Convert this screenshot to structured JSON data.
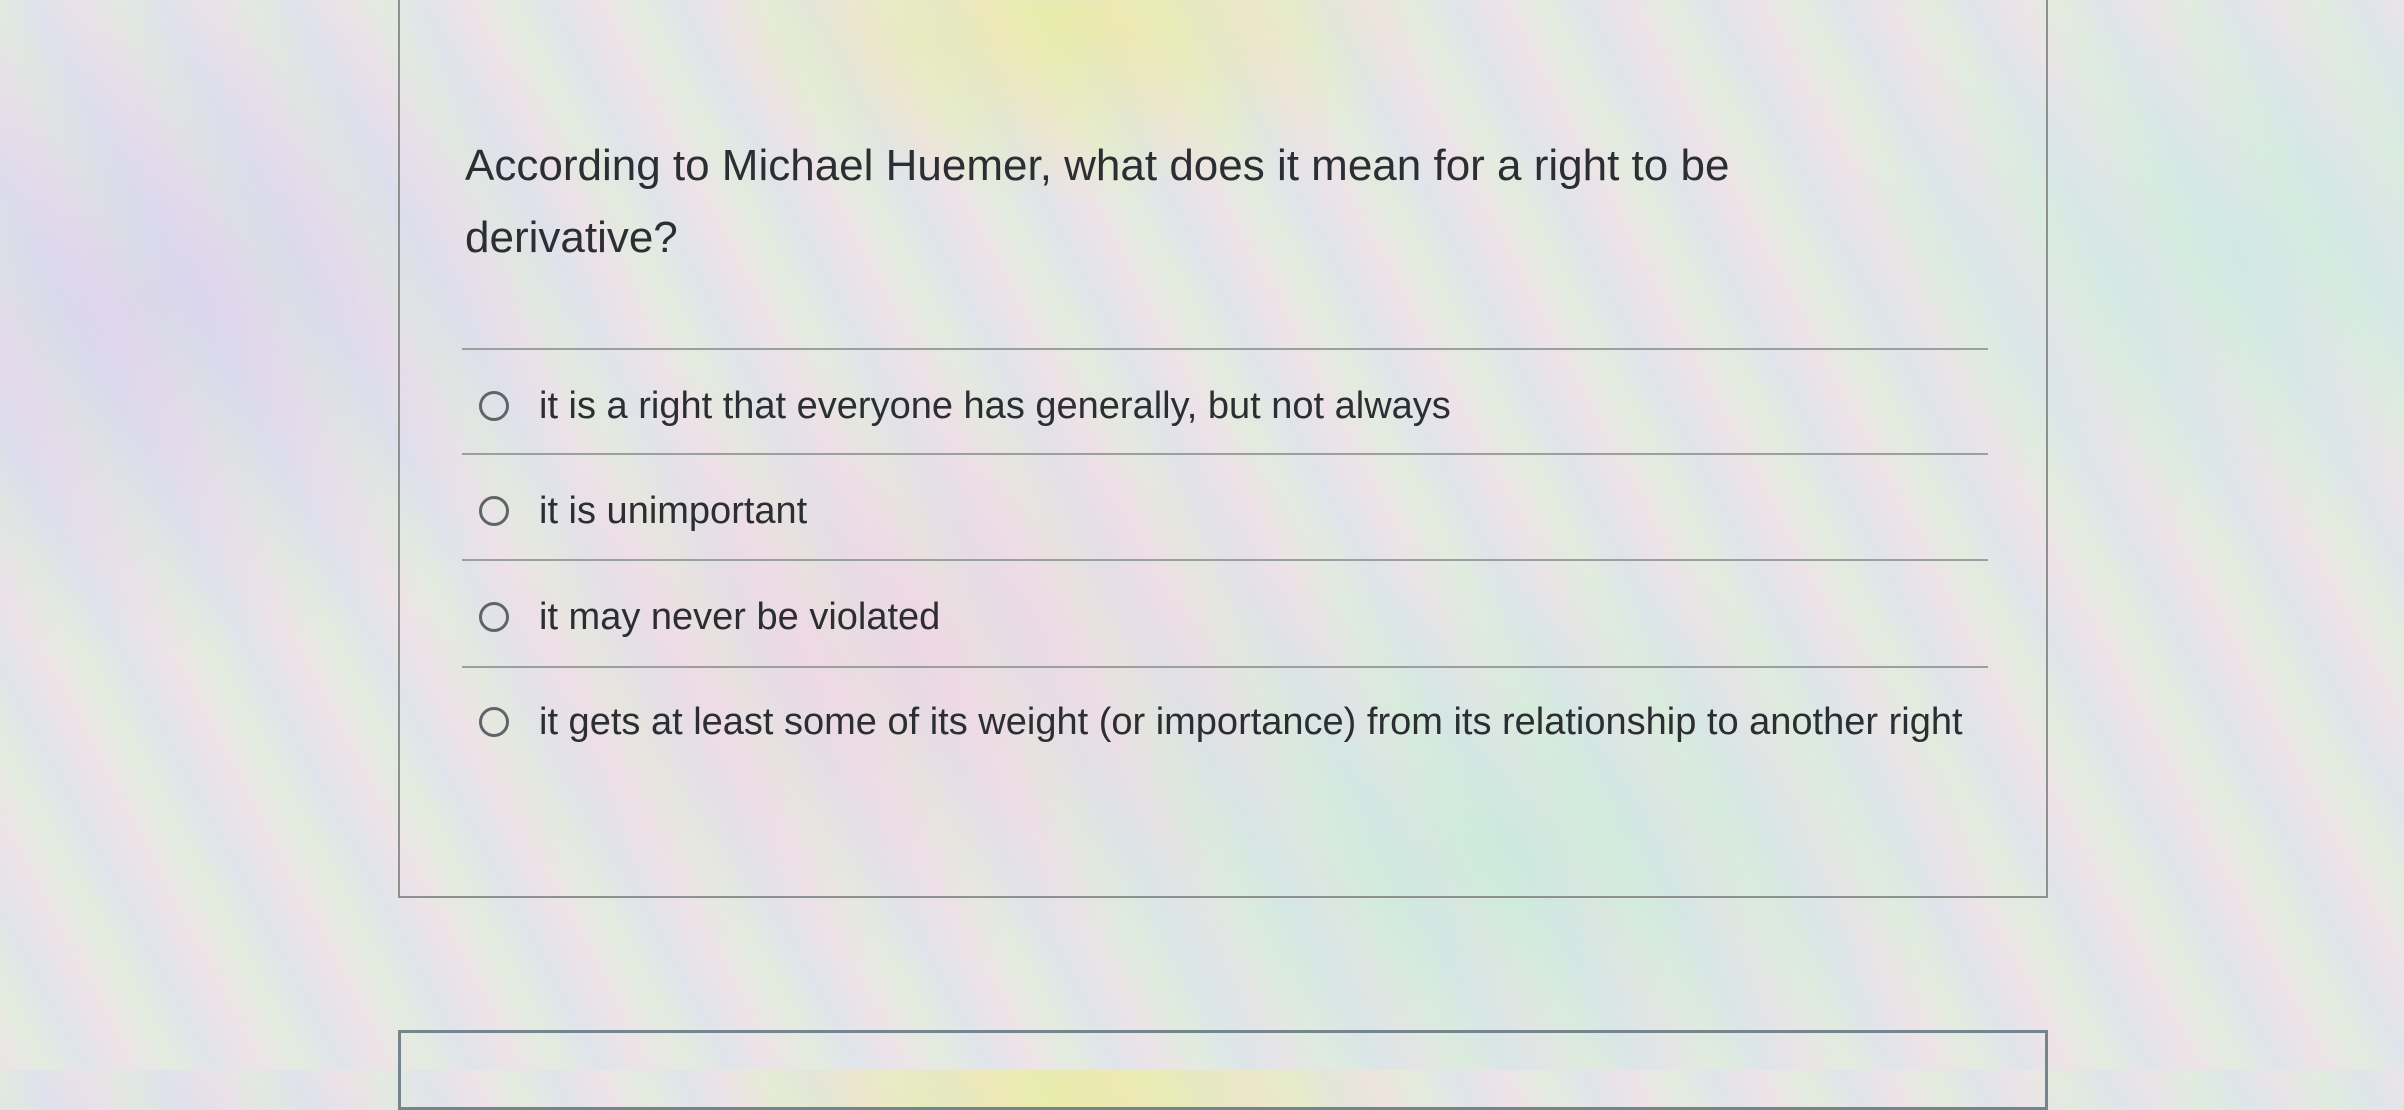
{
  "question": {
    "text": "According to Michael Huemer, what does it mean for a right to be derivative?"
  },
  "options": [
    {
      "label": "it is a right that everyone has generally, but not always",
      "selected": false
    },
    {
      "label": "it is unimportant",
      "selected": false
    },
    {
      "label": "it may never be violated",
      "selected": false
    },
    {
      "label": "it gets at least some of its weight (or importance) from its relationship to another right",
      "selected": false
    }
  ]
}
